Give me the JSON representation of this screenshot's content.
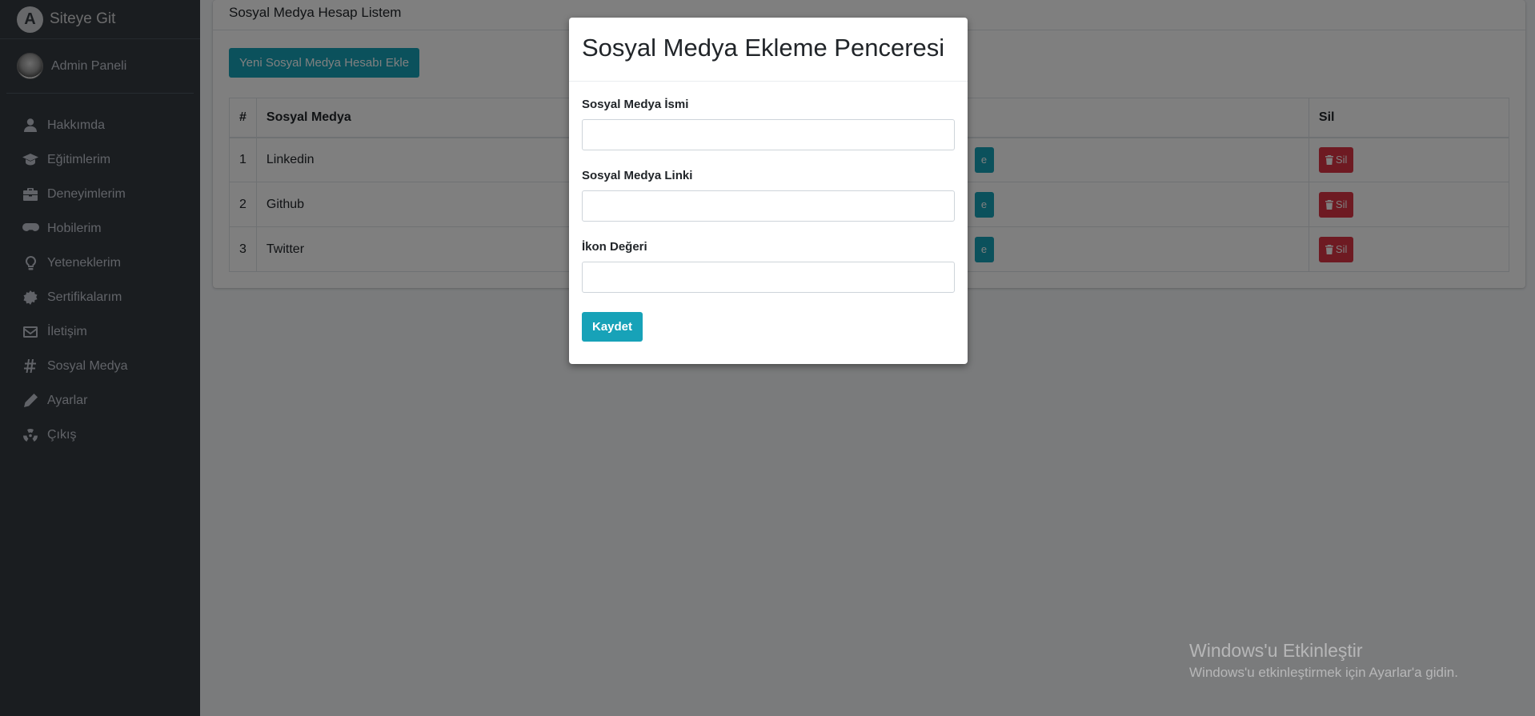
{
  "sidebar": {
    "brand": "Siteye Git",
    "user": "Admin Paneli",
    "items": [
      {
        "label": "Hakkımda",
        "icon": "user-icon"
      },
      {
        "label": "Eğitimlerim",
        "icon": "graduation-cap-icon"
      },
      {
        "label": "Deneyimlerim",
        "icon": "briefcase-icon"
      },
      {
        "label": "Hobilerim",
        "icon": "gamepad-icon"
      },
      {
        "label": "Yeteneklerim",
        "icon": "lightbulb-icon"
      },
      {
        "label": "Sertifikalarım",
        "icon": "certificate-icon"
      },
      {
        "label": "İletişim",
        "icon": "envelope-icon"
      },
      {
        "label": "Sosyal Medya",
        "icon": "hashtag-icon"
      },
      {
        "label": "Ayarlar",
        "icon": "pencil-icon"
      },
      {
        "label": "Çıkış",
        "icon": "radiation-icon"
      }
    ]
  },
  "card": {
    "title": "Sosyal Medya Hesap Listem",
    "add_button": "Yeni Sosyal Medya Hesabı Ekle",
    "table": {
      "headers": [
        "#",
        "Sosyal Medya",
        "Sil"
      ],
      "rows": [
        {
          "no": "1",
          "name": "Linkedin",
          "update": "e",
          "delete": "Sil"
        },
        {
          "no": "2",
          "name": "Github",
          "update": "e",
          "delete": "Sil"
        },
        {
          "no": "3",
          "name": "Twitter",
          "update": "e",
          "delete": "Sil"
        }
      ]
    }
  },
  "modal": {
    "title": "Sosyal Medya Ekleme Penceresi",
    "fields": [
      {
        "label": "Sosyal Medya İsmi",
        "value": ""
      },
      {
        "label": "Sosyal Medya Linki",
        "value": ""
      },
      {
        "label": "İkon Değeri",
        "value": ""
      }
    ],
    "save_button": "Kaydet"
  },
  "watermark": {
    "title": "Windows'u Etkinleştir",
    "subtitle": "Windows'u etkinleştirmek için Ayarlar'a gidin."
  }
}
